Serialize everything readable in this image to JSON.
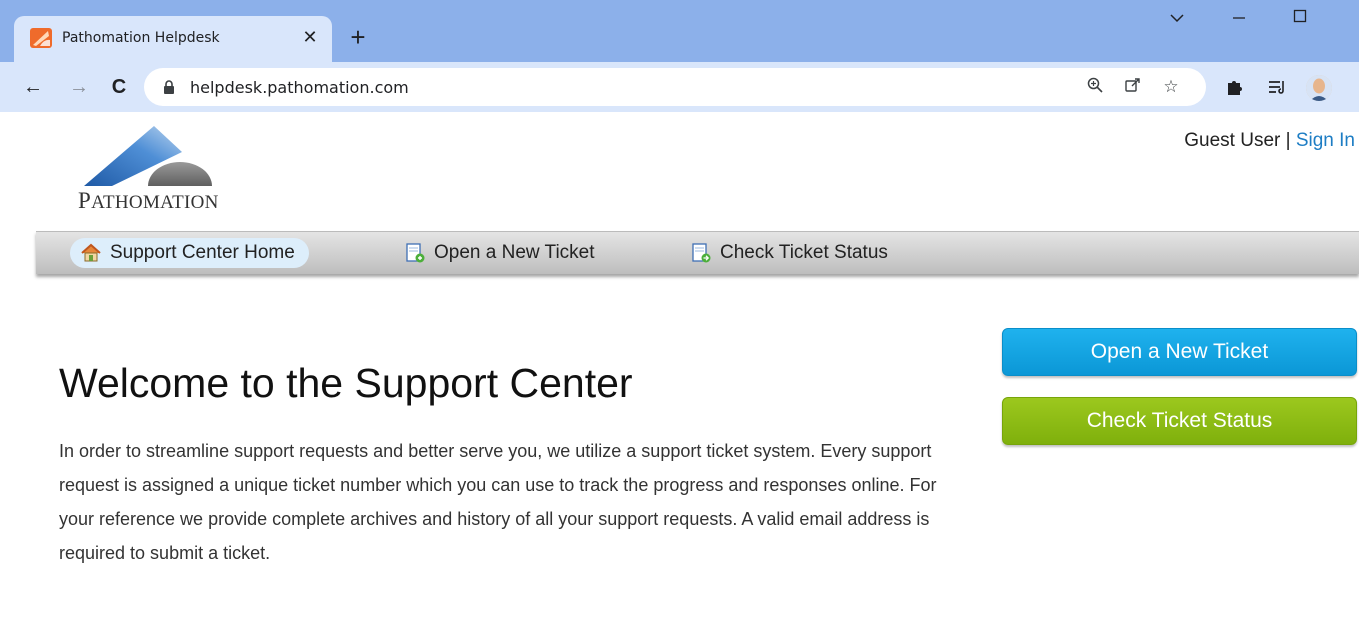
{
  "browser": {
    "tab_title": "Pathomation Helpdesk",
    "url": "helpdesk.pathomation.com",
    "icons": [
      "favicon-icon",
      "close-icon",
      "new-tab-icon",
      "chevron-down-icon",
      "minimize-icon",
      "maximize-icon",
      "back-icon",
      "forward-icon",
      "reload-icon",
      "lock-icon",
      "zoom-icon",
      "share-icon",
      "star-icon",
      "extensions-icon",
      "reading-list-icon",
      "profile-avatar"
    ]
  },
  "header": {
    "logo_text_cap": "P",
    "logo_text_rest": "ATHOMATION",
    "guest_user": "Guest User",
    "separator": "|",
    "sign_in": "Sign In"
  },
  "nav": {
    "items": [
      {
        "label": "Support Center Home",
        "icon": "home-icon"
      },
      {
        "label": "Open a New Ticket",
        "icon": "new-ticket-icon"
      },
      {
        "label": "Check Ticket Status",
        "icon": "ticket-status-icon"
      }
    ]
  },
  "main": {
    "title": "Welcome to the Support Center",
    "intro": "In order to streamline support requests and better serve you, we utilize a support ticket system. Every support request is assigned a unique ticket number which you can use to track the progress and responses online. For your reference we provide complete archives and history of all your support requests. A valid email address is required to submit a ticket."
  },
  "sidebar": {
    "open_ticket": "Open a New Ticket",
    "check_status": "Check Ticket Status"
  },
  "colors": {
    "tabstrip": "#8cb0ea",
    "toolbar": "#d9e6fb",
    "accent_blue": "#0b97d6",
    "accent_green": "#7fb00c",
    "link": "#1d7dc4"
  }
}
